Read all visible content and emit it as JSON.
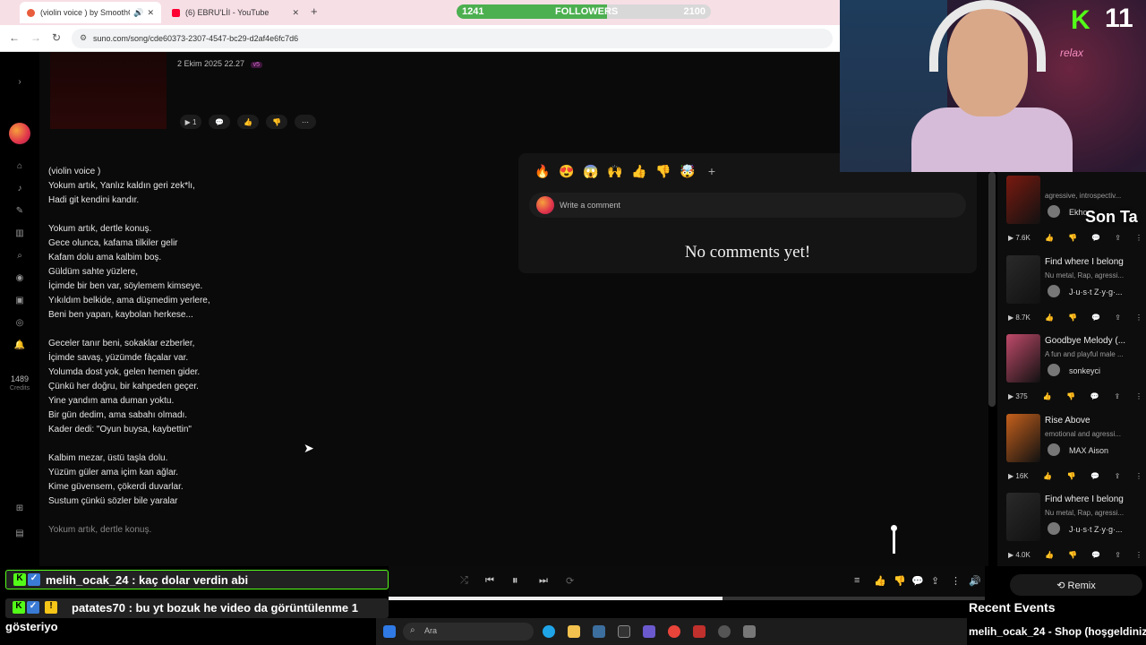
{
  "browser": {
    "tabs": [
      {
        "title": "(violin voice ) by SmoothChi",
        "active": true,
        "color": "#e85d3c"
      },
      {
        "title": "(6) EBRU'LİI - YouTube",
        "active": false,
        "color": "#ff0033"
      }
    ],
    "url": "suno.com/song/cde60373-2307-4547-bc29-d2af4e6fc7d6"
  },
  "followers": {
    "current": "1241",
    "label": "FOLLOWERS",
    "goal": "2100",
    "progress": 0.59
  },
  "sidebar": {
    "credits_value": "1489",
    "credits_label": "Credits"
  },
  "song": {
    "date": "2 Ekim 2025 22.27",
    "version": "v5",
    "play_count": "1",
    "lyrics": [
      "(violin voice )",
      "Yokum artık, Yanlız kaldın geri zek*lı,",
      "Hadi git kendini kandır.",
      "",
      "Yokum artık, dertle konuş.",
      "Gece olunca, kafama tilkiler gelir",
      "Kafam dolu ama kalbim boş.",
      "Güldüm sahte yüzlere,",
      "İçimde bir ben var, söylemem kimseye.",
      "Yıkıldım belkide, ama düşmedim yerlere,",
      "Beni ben yapan, kaybolan herkese...",
      "",
      "Geceler tanır beni, sokaklar ezberler,",
      "İçimde savaş, yüzümde fàçalar var.",
      "Yolumda dost yok, gelen hemen gider.",
      "Çünkü her doğru, bir kahpeden geçer.",
      "Yine yandım ama duman yoktu.",
      "Bir gün dedim, ama sabahı olmadı.",
      "Kader dedi: \"Oyun buysa, kaybettin\"",
      "",
      "Kalbim mezar, üstü taşla dolu.",
      "Yüzüm güler ama içim kan ağlar.",
      "Kime güvensem, çökerdi duvarlar.",
      "Sustum çünkü sözler bile yaralar",
      "",
      "Yokum artık, dertle konuş."
    ]
  },
  "comments": {
    "reactions": [
      "🔥",
      "😍",
      "😱",
      "🙌",
      "👍",
      "👎",
      "🤯",
      "+"
    ],
    "placeholder": "Write a comment",
    "empty_text": "No comments yet!"
  },
  "related": [
    {
      "title": "",
      "desc": "agressive, introspectiv...",
      "artist": "Ekho",
      "plays": "7.6K",
      "thumb": "#7a1a10"
    },
    {
      "title": "Find where I belong",
      "desc": "Nu metal, Rap, agressi...",
      "artist": "J·u·s·t Z·y·g·...",
      "plays": "8.7K",
      "thumb": "#2a2a2a"
    },
    {
      "title": "Goodbye Melody (...",
      "desc": "A fun and playful male ...",
      "artist": "sonkeyci",
      "plays": "375",
      "thumb": "#c04a6a"
    },
    {
      "title": "Rise Above",
      "desc": "emotional and agressi...",
      "artist": "MAX Aison",
      "plays": "16K",
      "thumb": "#c5601c"
    },
    {
      "title": "Find where I belong",
      "desc": "Nu metal, Rap, agressi...",
      "artist": "J·u·s·t Z·y·g·...",
      "plays": "4.0K",
      "thumb": "#2a2a2a"
    }
  ],
  "player": {
    "progress": 0.56,
    "remix_label": "Remix"
  },
  "stream": {
    "cam_number": "11",
    "cam_logo": "K",
    "cam_text": "relax",
    "overlay_text": "Son Ta",
    "chat": [
      {
        "text": "melih_ocak_24 : kaç dolar verdin abi"
      },
      {
        "text": "patates70 : bu yt bozuk he video da görüntülenme 1",
        "cont": "gösteriyo"
      }
    ],
    "recent_events": "Recent Events",
    "ticker": "melih_ocak_24 - Shop (hoşgeldiniz"
  },
  "taskbar": {
    "search_placeholder": "Ara"
  }
}
